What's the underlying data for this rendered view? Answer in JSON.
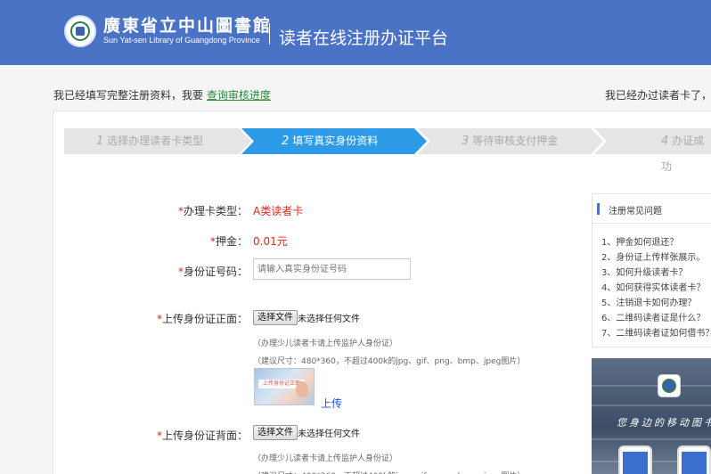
{
  "header": {
    "library_name_cn": "廣東省立中山圖書館",
    "library_name_en": "Sun Yat-sen Library of Guangdong Province",
    "platform_title": "读者在线注册办证平台"
  },
  "notice": {
    "left_prefix": "我已经填写完整注册资料，我要",
    "left_link": "查询审核进度",
    "right_text": "我已经办过读者卡了，我"
  },
  "steps": [
    {
      "num": "1",
      "label": "选择办理读者卡类型",
      "active": false
    },
    {
      "num": "2",
      "label": "填写真实身份资料",
      "active": true
    },
    {
      "num": "3",
      "label": "等待审核支付押金",
      "active": false
    },
    {
      "num": "4",
      "label": "办证成功",
      "active": false
    }
  ],
  "form": {
    "card_type_label": "办理卡类型：",
    "card_type_value": "A类读者卡",
    "deposit_label": "押金：",
    "deposit_value": "0.01元",
    "id_label": "身份证号码：",
    "id_placeholder": "请输入真实身份证号码",
    "front_label": "上传身份证正面：",
    "back_label": "上传身份证背面：",
    "choose_file": "选择文件",
    "no_file": "未选择任何文件",
    "hint_guardian": "（办理少儿读者卡请上传监护人身份证）",
    "hint_size": "（建议尺寸：480*360，不超过400k的jpg、gif、png、bmp、jpeg图片）",
    "thumb_text": "上传身份证正面",
    "upload_label": "上传",
    "required_mark": "*"
  },
  "faq": {
    "title": "注册常见问题",
    "items": [
      "1、押金如何退还？",
      "2、身份证上传样张展示。",
      "3、如何升级读者卡？",
      "4、如何获得实体读者卡？",
      "5、注销退卡如何办理？",
      "6、二维码读者证是什么？",
      "7、二维码读者证如何借书？"
    ]
  },
  "promo": {
    "slogan": "您身边的移动图书"
  },
  "colors": {
    "header_bg": "#4a72c5",
    "step_active": "#2d9be8",
    "step_inactive": "#e5e5e5",
    "required": "#e0261a",
    "link": "#2a8a3a"
  }
}
